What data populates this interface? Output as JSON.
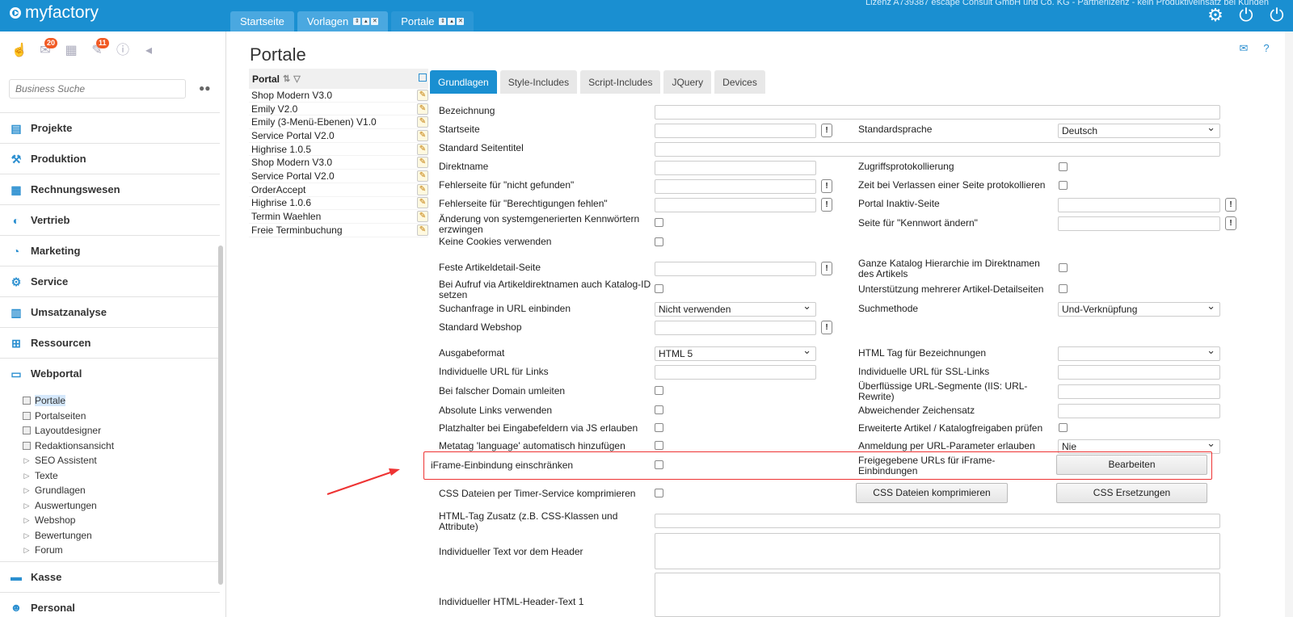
{
  "app": {
    "logo": "myfactory",
    "license": "Lizenz A739387 escape Consult GmbH und Co. KG - Partnerlizenz - kein Produktiveinsatz bei Kunden",
    "tabs": [
      {
        "label": "Startseite"
      },
      {
        "label": "Vorlagen"
      },
      {
        "label": "Portale"
      }
    ]
  },
  "sidebar": {
    "badges": {
      "notifications": "20",
      "messages": "11"
    },
    "search_placeholder": "Business Suche",
    "nav": [
      {
        "label": "Projekte",
        "icon": "projects-icon"
      },
      {
        "label": "Produktion",
        "icon": "production-icon"
      },
      {
        "label": "Rechnungswesen",
        "icon": "accounting-icon"
      },
      {
        "label": "Vertrieb",
        "icon": "sales-icon"
      },
      {
        "label": "Marketing",
        "icon": "marketing-icon"
      },
      {
        "label": "Service",
        "icon": "service-icon"
      },
      {
        "label": "Umsatzanalyse",
        "icon": "analysis-icon"
      },
      {
        "label": "Ressourcen",
        "icon": "resources-icon"
      },
      {
        "label": "Webportal",
        "icon": "webportal-icon"
      }
    ],
    "subnav": [
      {
        "label": "Portale"
      },
      {
        "label": "Portalseiten"
      },
      {
        "label": "Layoutdesigner"
      },
      {
        "label": "Redaktionsansicht"
      },
      {
        "label": "SEO Assistent"
      },
      {
        "label": "Texte"
      },
      {
        "label": "Grundlagen"
      },
      {
        "label": "Auswertungen"
      },
      {
        "label": "Webshop"
      },
      {
        "label": "Bewertungen"
      },
      {
        "label": "Forum"
      }
    ],
    "nav_bottom": [
      {
        "label": "Kasse"
      },
      {
        "label": "Personal"
      }
    ]
  },
  "page": {
    "title": "Portale",
    "list_header": "Portal",
    "portals": [
      "Shop Modern V3.0",
      "Emily V2.0",
      "Emily (3-Menü-Ebenen) V1.0",
      "Service Portal V2.0",
      "Highrise 1.0.5",
      "Shop Modern V3.0",
      "Service Portal V2.0",
      "OrderAccept",
      "Highrise 1.0.6",
      "Termin Waehlen",
      "Freie Terminbuchung"
    ],
    "form_tabs": [
      "Grundlagen",
      "Style-Includes",
      "Script-Includes",
      "JQuery",
      "Devices"
    ]
  },
  "form": {
    "bezeichnung": "Bezeichnung",
    "startseite": "Startseite",
    "standardsprache": "Standardsprache",
    "standardsprache_value": "Deutsch",
    "seitentitel": "Standard Seitentitel",
    "direktname": "Direktname",
    "zugriffsprotokollierung": "Zugriffsprotokollierung",
    "fehler_nicht_gefunden": "Fehlerseite für \"nicht gefunden\"",
    "zeit_verlassen": "Zeit bei Verlassen einer Seite protokollieren",
    "fehler_berechtigungen": "Fehlerseite für \"Berechtigungen fehlen\"",
    "portal_inaktiv": "Portal Inaktiv-Seite",
    "aenderung_kennwort_1": "Änderung von systemgenerierten Kennwörtern",
    "aenderung_kennwort_2": "erzwingen",
    "seite_kennwort": "Seite für \"Kennwort ändern\"",
    "keine_cookies": "Keine Cookies verwenden",
    "feste_artikel": "Feste Artikeldetail-Seite",
    "ganze_katalog_1": "Ganze Katalog Hierarchie im Direktnamen",
    "ganze_katalog_2": "des Artikels",
    "aufruf_katalog_1": "Bei Aufruf via Artikeldirektnamen auch Katalog-ID",
    "aufruf_katalog_2": "setzen",
    "mehrere_detail": "Unterstützung mehrerer Artikel-Detailseiten",
    "suchanfrage": "Suchanfrage in URL einbinden",
    "suchanfrage_value": "Nicht verwenden",
    "suchmethode": "Suchmethode",
    "suchmethode_value": "Und-Verknüpfung",
    "webshop": "Standard Webshop",
    "ausgabeformat": "Ausgabeformat",
    "ausgabeformat_value": "HTML 5",
    "html_tag_bez": "HTML Tag für Bezeichnungen",
    "url_links": "Individuelle URL für Links",
    "url_ssl": "Individuelle URL für SSL-Links",
    "falsche_domain": "Bei falscher Domain umleiten",
    "url_segmente_1": "Überflüssige URL-Segmente (IIS: URL-",
    "url_segmente_2": "Rewrite)",
    "absolute_links": "Absolute Links verwenden",
    "zeichensatz": "Abweichender Zeichensatz",
    "platzhalter": "Platzhalter bei Eingabefeldern via JS erlauben",
    "erweiterte_freigaben": "Erweiterte Artikel / Katalogfreigaben prüfen",
    "metatag": "Metatag 'language' automatisch hinzufügen",
    "anmeldung_url": "Anmeldung per URL-Parameter erlauben",
    "anmeldung_value": "Nie",
    "iframe": "iFrame-Einbindung einschränken",
    "freigegebene_1": "Freigegebene URLs für iFrame-",
    "freigegebene_2": "Einbindungen",
    "bearbeiten": "Bearbeiten",
    "css_timer": "CSS Dateien per Timer-Service komprimieren",
    "css_komprimieren": "CSS Dateien komprimieren",
    "css_ersetzungen": "CSS Ersetzungen",
    "html_tag_zusatz_1": "HTML-Tag Zusatz (z.B. CSS-Klassen und",
    "html_tag_zusatz_2": "Attribute)",
    "text_header": "Individueller Text vor dem Header",
    "html_header_1": "Individueller HTML-Header-Text 1"
  }
}
